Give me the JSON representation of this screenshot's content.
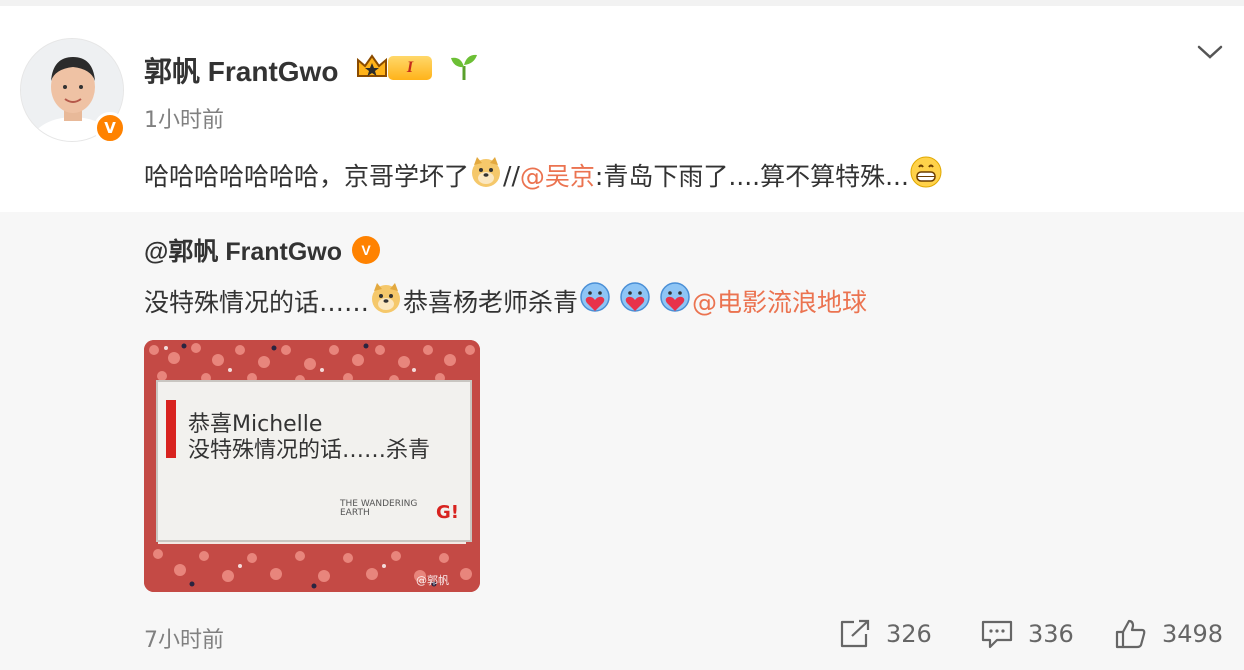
{
  "post": {
    "author_name": "郭帆 FrantGwo",
    "level_badge": "I",
    "verified_mark": "V",
    "time": "1小时前",
    "text_part1": "哈哈哈哈哈哈哈，京哥学坏了",
    "text_part2": "//",
    "mention": "@吴京",
    "text_part3": ":青岛下雨了....算不算特殊..."
  },
  "repost": {
    "author": "@郭帆 FrantGwo",
    "verified_mark": "V",
    "text_part1": "没特殊情况的话……",
    "text_part2": "恭喜杨老师杀青 ",
    "mention": "@电影流浪地球",
    "image": {
      "line1": "恭喜Michelle",
      "line2": "没特殊情况的话……杀青",
      "logo_text": "THE WANDERING EARTH",
      "g_mark": "G!",
      "watermark": "@郭帆"
    },
    "time": "7小时前"
  },
  "actions": {
    "share_count": "326",
    "comment_count": "336",
    "like_count": "3498"
  },
  "icons": {
    "chevron": "chevron-down-icon",
    "share": "share-icon",
    "comment": "comment-icon",
    "like": "thumbs-up-icon"
  },
  "colors": {
    "mention": "#eb7350",
    "verified": "#ff8200",
    "repost_bg": "#f7f7f7"
  }
}
